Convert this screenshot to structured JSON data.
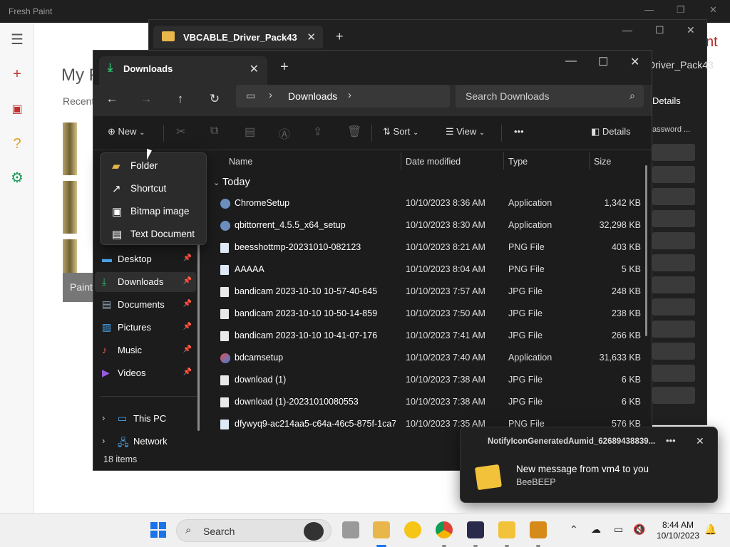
{
  "fresh_paint": {
    "title": "Fresh Paint",
    "heading": "My F",
    "recent_label": "Recent",
    "paint_tile_label": "Paint",
    "red_text": "nt"
  },
  "vbcable_window": {
    "tab_title": "VBCABLE_Driver_Pack43",
    "address_fragment": "Driver_Pack43",
    "details_label": "Details",
    "password_fragment": "assword ..."
  },
  "explorer": {
    "tab_title": "Downloads",
    "address": {
      "crumb": "Downloads"
    },
    "search": {
      "placeholder": "Search Downloads"
    },
    "toolbar": {
      "new_label": "New",
      "sort_label": "Sort",
      "view_label": "View",
      "more_label": "•••",
      "details_label": "Details"
    },
    "new_menu": [
      {
        "label": "Folder",
        "icon": "folder-icon"
      },
      {
        "label": "Shortcut",
        "icon": "shortcut-icon"
      },
      {
        "label": "Bitmap image",
        "icon": "bitmap-icon"
      },
      {
        "label": "Text Document",
        "icon": "text-document-icon"
      }
    ],
    "nav_items": [
      {
        "label": "Desktop",
        "icon": "desktop-icon",
        "pinned": true
      },
      {
        "label": "Downloads",
        "icon": "download-icon",
        "pinned": true,
        "selected": true
      },
      {
        "label": "Documents",
        "icon": "documents-icon",
        "pinned": true
      },
      {
        "label": "Pictures",
        "icon": "pictures-icon",
        "pinned": true
      },
      {
        "label": "Music",
        "icon": "music-icon",
        "pinned": true
      },
      {
        "label": "Videos",
        "icon": "videos-icon",
        "pinned": true
      }
    ],
    "nav_roots": [
      {
        "label": "This PC",
        "icon": "pc-icon"
      },
      {
        "label": "Network",
        "icon": "network-icon"
      }
    ],
    "columns": {
      "name": "Name",
      "date": "Date modified",
      "type": "Type",
      "size": "Size"
    },
    "group_label": "Today",
    "files": [
      {
        "name": "ChromeSetup",
        "date": "10/10/2023 8:36 AM",
        "type": "Application",
        "size": "1,342 KB",
        "kind": "app"
      },
      {
        "name": "qbittorrent_4.5.5_x64_setup",
        "date": "10/10/2023 8:30 AM",
        "type": "Application",
        "size": "32,298 KB",
        "kind": "app"
      },
      {
        "name": "beesshottmp-20231010-082123",
        "date": "10/10/2023 8:21 AM",
        "type": "PNG File",
        "size": "403 KB",
        "kind": "png"
      },
      {
        "name": "AAAAA",
        "date": "10/10/2023 8:04 AM",
        "type": "PNG File",
        "size": "5 KB",
        "kind": "png"
      },
      {
        "name": "bandicam 2023-10-10 10-57-40-645",
        "date": "10/10/2023 7:57 AM",
        "type": "JPG File",
        "size": "248 KB",
        "kind": "jpg"
      },
      {
        "name": "bandicam 2023-10-10 10-50-14-859",
        "date": "10/10/2023 7:50 AM",
        "type": "JPG File",
        "size": "238 KB",
        "kind": "jpg"
      },
      {
        "name": "bandicam 2023-10-10 10-41-07-176",
        "date": "10/10/2023 7:41 AM",
        "type": "JPG File",
        "size": "266 KB",
        "kind": "jpg"
      },
      {
        "name": "bdcamsetup",
        "date": "10/10/2023 7:40 AM",
        "type": "Application",
        "size": "31,633 KB",
        "kind": "bd"
      },
      {
        "name": "download (1)",
        "date": "10/10/2023 7:38 AM",
        "type": "JPG File",
        "size": "6 KB",
        "kind": "jpg"
      },
      {
        "name": "download (1)-20231010080553",
        "date": "10/10/2023 7:38 AM",
        "type": "JPG File",
        "size": "6 KB",
        "kind": "jpg"
      },
      {
        "name": "dfywyq9-ac214aa5-c64a-46c5-875f-1ca7...",
        "date": "10/10/2023 7:35 AM",
        "type": "PNG File",
        "size": "576 KB",
        "kind": "png"
      }
    ],
    "status": "18 items"
  },
  "notification": {
    "app_id": "NotifyIconGeneratedAumid_62689438839...",
    "message": "New message from vm4 to you",
    "source": "BeeBEEP"
  },
  "taskbar": {
    "search_label": "Search",
    "time": "8:44 AM",
    "date": "10/10/2023"
  }
}
